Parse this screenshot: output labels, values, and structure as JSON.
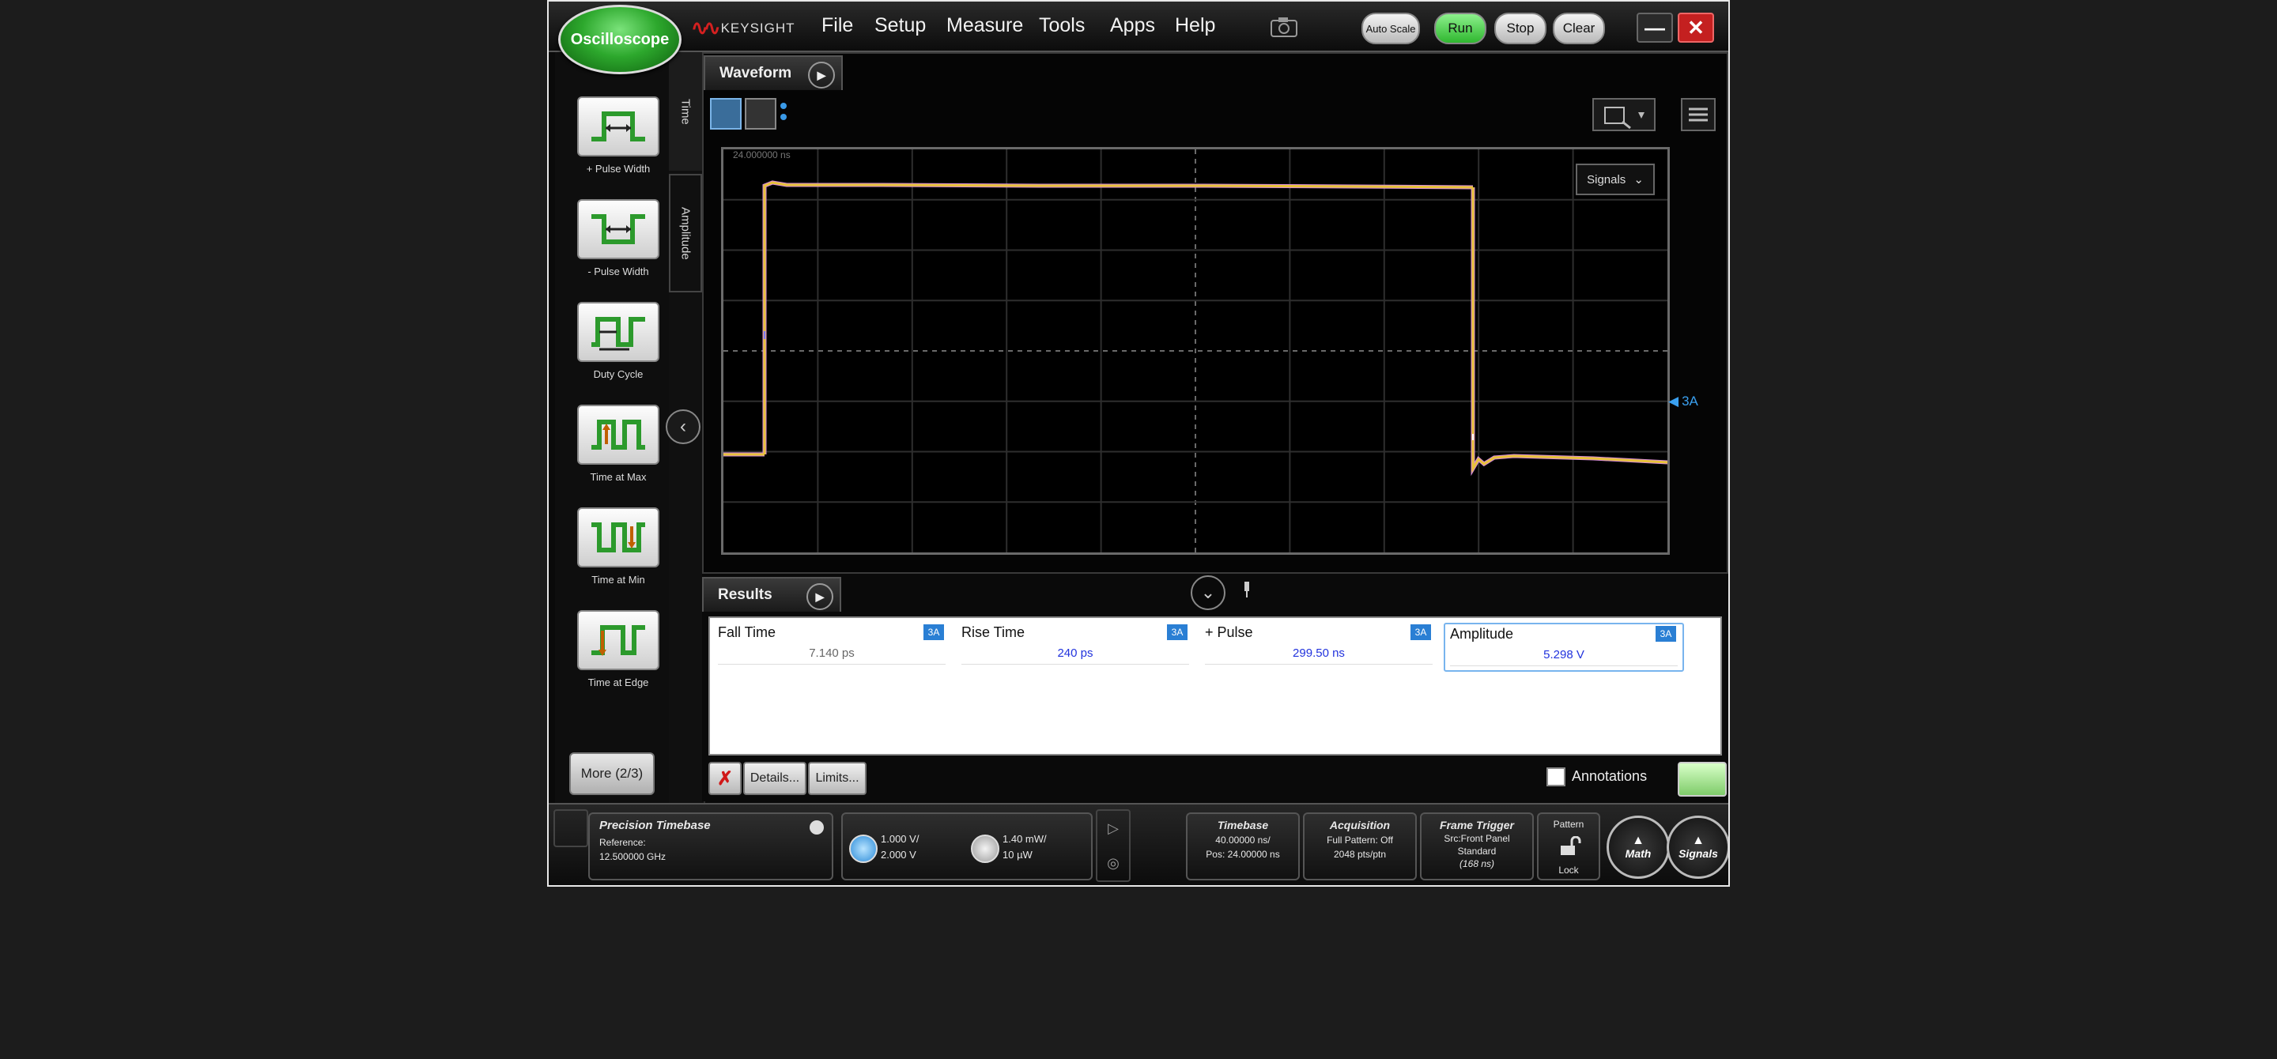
{
  "app": {
    "mode_button": "Oscilloscope",
    "brand": "KEYSIGHT",
    "menu": [
      "File",
      "Setup",
      "Measure",
      "Tools",
      "Apps",
      "Help"
    ],
    "controls": {
      "auto_scale": "Auto Scale",
      "run": "Run",
      "stop": "Stop",
      "clear": "Clear"
    },
    "window": {
      "minimize": "—",
      "close": "✕"
    }
  },
  "palette": {
    "tools": [
      {
        "label": "+ Pulse Width",
        "icon": "positive-pulse-width-icon"
      },
      {
        "label": "- Pulse Width",
        "icon": "negative-pulse-width-icon"
      },
      {
        "label": "Duty Cycle",
        "icon": "duty-cycle-icon"
      },
      {
        "label": "Time at Max",
        "icon": "time-at-max-icon"
      },
      {
        "label": "Time at Min",
        "icon": "time-at-min-icon"
      },
      {
        "label": "Time at Edge",
        "icon": "time-at-edge-icon"
      }
    ],
    "more": "More (2/3)",
    "tabs": {
      "time": "Time",
      "amplitude": "Amplitude"
    }
  },
  "waveform": {
    "tab": "Waveform",
    "signals_dropdown": "Signals",
    "time_label": "24.000000 ns",
    "marker_label": "3A",
    "trace_color": "#e8c23a",
    "trace_shadow_color": "#d58bd8"
  },
  "results": {
    "tab": "Results",
    "measurements": [
      {
        "name": "Fall Time",
        "badge": "3A",
        "value": "7.140 ps"
      },
      {
        "name": "Rise Time",
        "badge": "3A",
        "value": "240 ps"
      },
      {
        "name": "+ Pulse",
        "badge": "3A",
        "value": "299.50 ns"
      },
      {
        "name": "Amplitude",
        "badge": "3A",
        "value": "5.298 V"
      }
    ],
    "buttons": {
      "delete": "✗",
      "details": "Details...",
      "limits": "Limits..."
    },
    "annotations_label": "Annotations"
  },
  "bottom": {
    "timebase_ref": {
      "title": "Precision Timebase",
      "line1": "Reference:",
      "line2": "12.500000 GHz"
    },
    "channel1": {
      "scale": "1.000 V/",
      "offset": "2.000 V"
    },
    "channel2": {
      "scale": "1.40 mW/",
      "offset": "10 µW"
    },
    "timebase": {
      "title": "Timebase",
      "line1": "40.00000 ns/",
      "line2": "Pos: 24.00000 ns"
    },
    "acquisition": {
      "title": "Acquisition",
      "line1": "Full Pattern: Off",
      "line2": "2048 pts/ptn"
    },
    "trigger": {
      "title": "Frame Trigger",
      "line1": "Src:Front Panel",
      "line2": "Standard",
      "line3": "(168 ns)"
    },
    "pattern": {
      "line1": "Pattern",
      "line2": "Lock"
    },
    "math": "Math",
    "signals": "Signals"
  }
}
